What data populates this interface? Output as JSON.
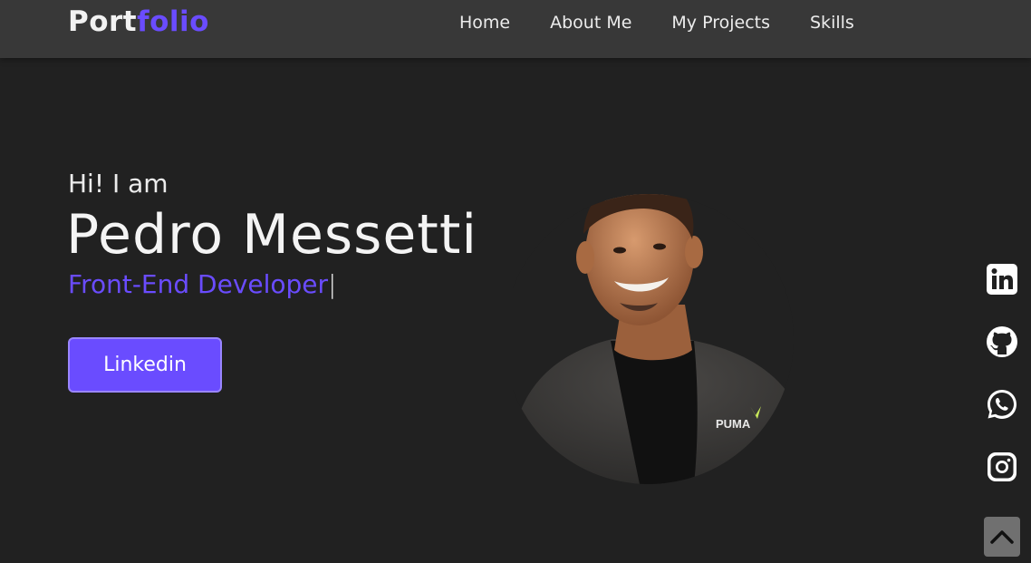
{
  "nav": {
    "logo_main": "Port",
    "logo_accent": "folio",
    "links": [
      "Home",
      "About Me",
      "My Projects",
      "Skills"
    ]
  },
  "hero": {
    "greeting": "Hi! I am",
    "name": "Pedro Messetti",
    "role": "Front-End Developer",
    "cursor": "|",
    "button_label": "Linkedin",
    "shirt_logo": "PUMA"
  },
  "social_icons": [
    "linkedin-icon",
    "github-icon",
    "whatsapp-icon",
    "instagram-icon"
  ],
  "scroll_top_icon": "chevron-up-icon",
  "colors": {
    "background": "#212121",
    "navbar": "#383838",
    "accent": "#6a4cff",
    "text": "#ececec",
    "scroll_button": "#707070"
  }
}
